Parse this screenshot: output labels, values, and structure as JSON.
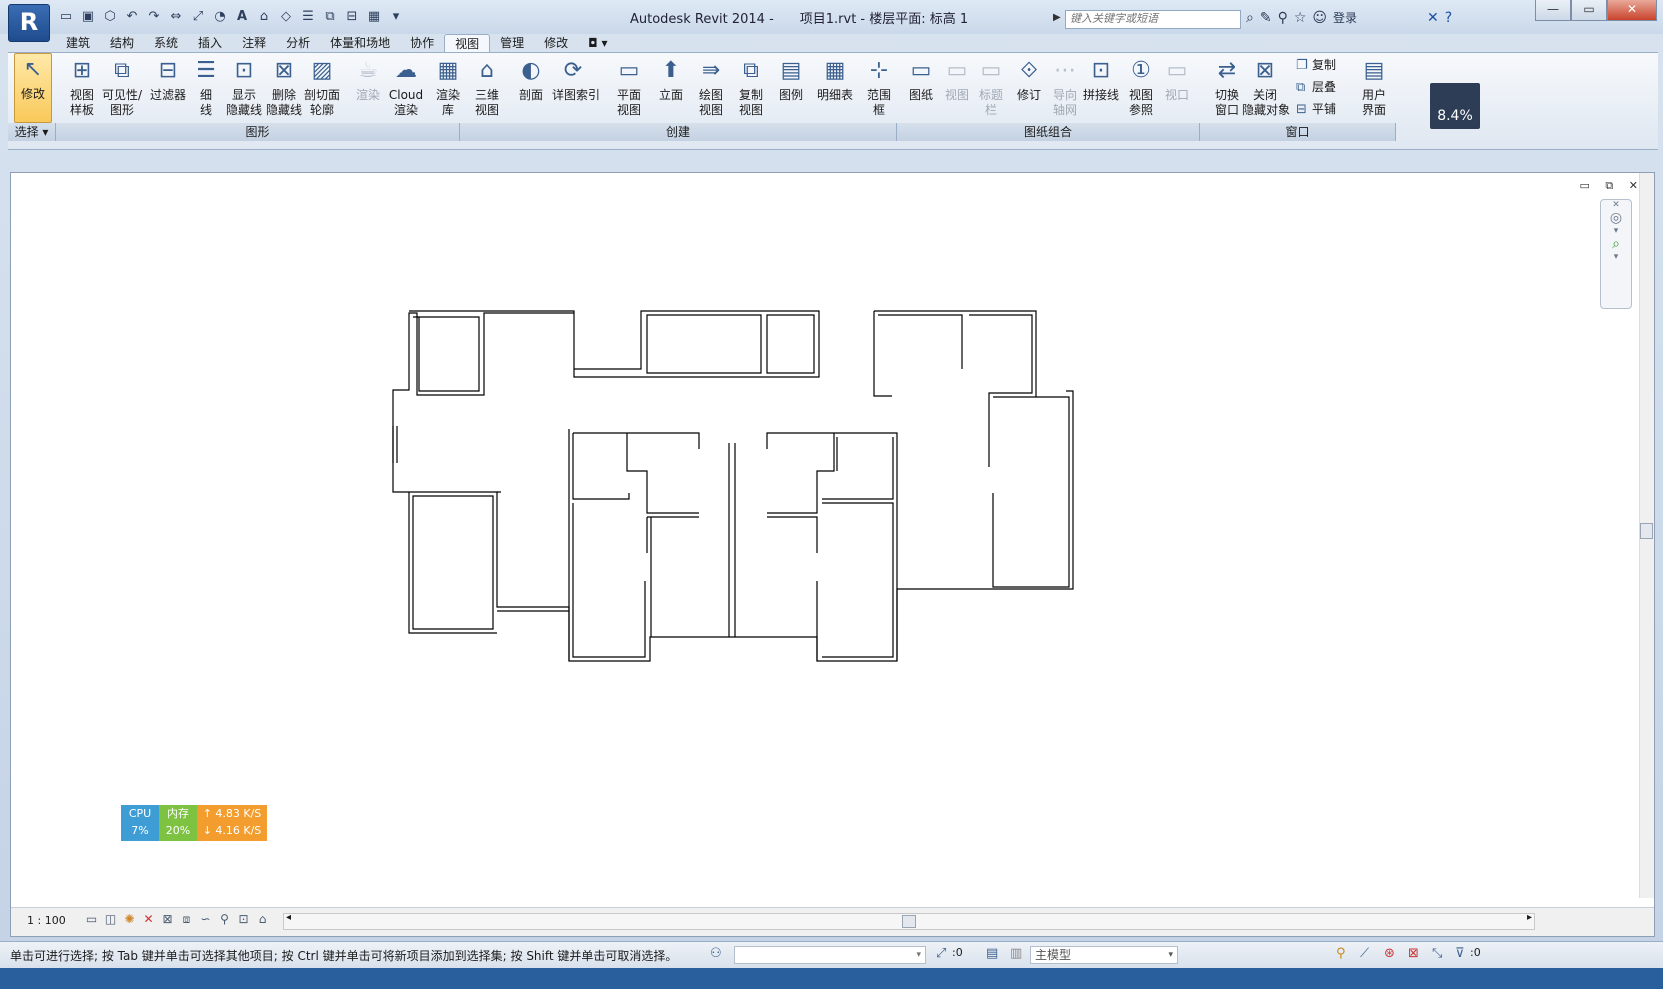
{
  "app": {
    "logo": "R",
    "title": "Autodesk Revit 2014 -",
    "subtitle": "项目1.rvt - 楼层平面: 标高 1"
  },
  "qat_icons": [
    "open-icon",
    "save-icon",
    "sync-icon",
    "undo-icon",
    "redo-icon",
    "measure-icon",
    "dimension-icon",
    "tag-icon",
    "text-icon",
    "3d-icon",
    "section-icon",
    "thin-lines-icon",
    "close-hidden-icon",
    "switch-window-icon",
    "ui-icon",
    "dropdown-icon"
  ],
  "search": {
    "placeholder": "键入关键字或短语"
  },
  "infobar": {
    "login": "登录"
  },
  "window_controls": {
    "minimize": "—",
    "maximize": "▭",
    "close": "✕"
  },
  "tabs": [
    "建筑",
    "结构",
    "系统",
    "插入",
    "注释",
    "分析",
    "体量和场地",
    "协作",
    "视图",
    "管理",
    "修改",
    "◘ ▾"
  ],
  "active_tab": "视图",
  "ribbon": {
    "modify": "修改",
    "graphics": [
      "视图\n样板",
      "可见性/\n图形",
      "过滤器",
      "细\n线",
      "显示\n隐藏线",
      "删除\n隐藏线",
      "剖切面\n轮廓"
    ],
    "render": [
      "渲染",
      "Cloud\n渲染",
      "渲染\n库"
    ],
    "create": [
      "三维\n视图",
      "剖面",
      "详图索引",
      "平面\n视图",
      "立面",
      "绘图\n视图",
      "复制\n视图",
      "图例",
      "明细表",
      "范围\n框"
    ],
    "sheet": [
      "图纸",
      "视图",
      "标题\n栏",
      "修订",
      "导向\n轴网",
      "拼接线",
      "视图\n参照",
      "视口"
    ],
    "window": [
      "切换\n窗口",
      "关闭\n隐藏对象"
    ],
    "window_small": [
      "复制",
      "层叠",
      "平铺"
    ],
    "ui": "用户\n界面",
    "panels": [
      "选择 ▾",
      "图形",
      "创建",
      "图纸组合",
      "窗口"
    ],
    "percent": "8.4%"
  },
  "view": {
    "scale": "1 : 100",
    "view_controls": "▭ ⧉ ✕"
  },
  "monitor": {
    "cpu_label": "CPU",
    "cpu_value": "7%",
    "mem_label": "内存",
    "mem_value": "20%",
    "up": "↑ 4.83 K/S",
    "down": "↓ 4.16 K/S"
  },
  "status": {
    "hint": "单击可进行选择; 按 Tab 键并单击可选择其他项目; 按 Ctrl 键并单击可将新项目添加到选择集; 按 Shift 键并单击可取消选择。",
    "filter_count": ":0",
    "model": "主模型",
    "select_count": ":0"
  }
}
